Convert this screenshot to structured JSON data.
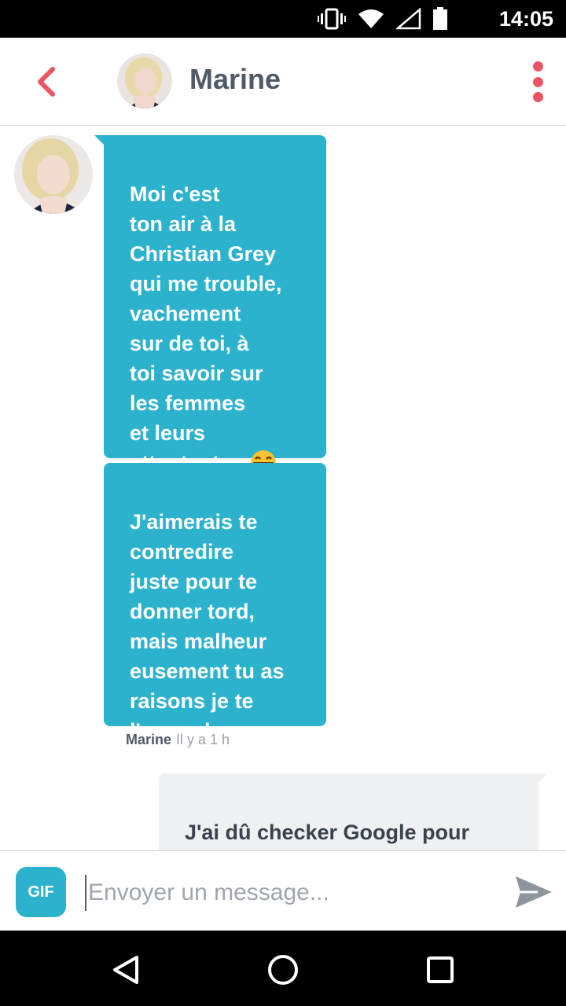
{
  "status_bar": {
    "time": "14:05",
    "icons": [
      "vibrate-icon",
      "wifi-icon",
      "signal-icon",
      "battery-icon"
    ]
  },
  "header": {
    "name": "Marine"
  },
  "messages": [
    {
      "from": "Marine",
      "text": "Moi c'est\nton air à la\nChristian Grey\nqui me trouble,\nvachement\nsur de toi, à\ntoi savoir sur\nles femmes\net leurs\nattentent ... "
    },
    {
      "from": "Marine",
      "text": "J'aimerais te\ncontredire\njuste pour te\ndonner tord,\nmais malheur\neusement tu as\nraisons je te\nl'accorde"
    },
    {
      "from": "me",
      "text": "J'ai dû checker Google pour\nvoir qui était ce Christian"
    }
  ],
  "meta": {
    "sender": "Marine",
    "time": "Il y a 1 h"
  },
  "input": {
    "gif_label": "GIF",
    "placeholder": "Envoyer un message..."
  },
  "colors": {
    "accent": "#ee5563",
    "bubble_in": "#2db2ce",
    "bubble_out": "#eff0f2"
  }
}
